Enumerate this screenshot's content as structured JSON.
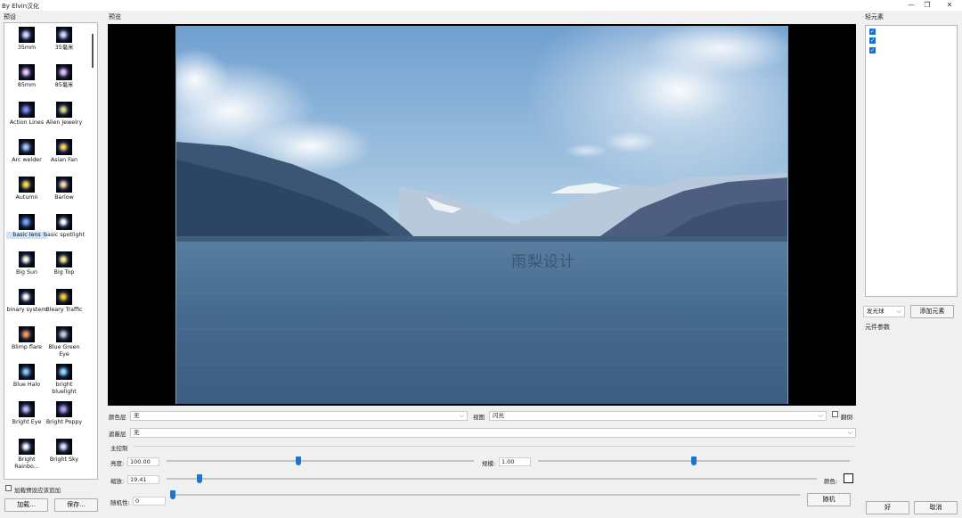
{
  "window": {
    "title": "By Elvin汉化"
  },
  "sidebar": {
    "title": "预设",
    "presets": [
      {
        "label": "35mm",
        "color": "#d8d8ff"
      },
      {
        "label": "35毫米",
        "color": "#cfd8ff"
      },
      {
        "label": "85mm",
        "color": "#f0c8ff"
      },
      {
        "label": "85毫米",
        "color": "#e8c0f0"
      },
      {
        "label": "Action Lines",
        "color": "#7a8cff"
      },
      {
        "label": "Alien Jewelry",
        "color": "#e0e080"
      },
      {
        "label": "Arc welder",
        "color": "#a0c8ff"
      },
      {
        "label": "Asian Fan",
        "color": "#ffd060"
      },
      {
        "label": "Autumn",
        "color": "#ffdd33"
      },
      {
        "label": "Barlow",
        "color": "#ffd9a0"
      },
      {
        "label": "basic lens",
        "color": "#6fa8ff"
      },
      {
        "label": "basic spotlight",
        "color": "#ffffff"
      },
      {
        "label": "Big Sun",
        "color": "#ffffee"
      },
      {
        "label": "Big Top",
        "color": "#ffee88"
      },
      {
        "label": "binary system",
        "color": "#ffffff"
      },
      {
        "label": "Bleary Traffic",
        "color": "#ffcc22"
      },
      {
        "label": "Blimp flare",
        "color": "#ff9944"
      },
      {
        "label": "Blue Green Eye",
        "color": "#cccccc"
      },
      {
        "label": "Blue Halo",
        "color": "#88ccff"
      },
      {
        "label": "bright bluelight",
        "color": "#8fe0ff"
      },
      {
        "label": "Bright Eye",
        "color": "#c8b8ff"
      },
      {
        "label": "Bright Poppy",
        "color": "#b79cff"
      },
      {
        "label": "Bright Rainbo...",
        "color": "#ffffff"
      },
      {
        "label": "Bright Sky",
        "color": "#e0e8ff"
      }
    ],
    "load_on_apply_label": "加载预设应该追加",
    "load_button": "加载...",
    "save_button": "保存..."
  },
  "preview": {
    "label": "预览",
    "watermark": "雨梨设计"
  },
  "controls": {
    "color_layer_label": "颜色层",
    "color_layer_value": "无",
    "view_label": "视图",
    "view_value": "闪光",
    "flip_label": "翻倒",
    "mask_layer_label": "遮蔽层",
    "mask_layer_value": "无",
    "main_section": "主控制",
    "brightness_label": "亮度:",
    "brightness_value": "100.00",
    "brightness_fraction": 0.43,
    "scale_label": "规模:",
    "scale_value": "1.00",
    "scale_fraction": 0.5,
    "zoom_label": "缩放:",
    "zoom_value": "19.41",
    "zoom_fraction": 0.05,
    "color_label": "颜色:",
    "random_label": "随机性:",
    "random_value": "0",
    "random_fraction": 0.0,
    "random_button": "随机"
  },
  "right": {
    "elements_title": "轻元素",
    "checked_count_items": [
      "✓",
      "✓",
      "✓"
    ],
    "element_type": "发光球",
    "add_element_button": "添加元素",
    "params_title": "元件参数",
    "ok_button": "好",
    "cancel_button": "取消"
  }
}
